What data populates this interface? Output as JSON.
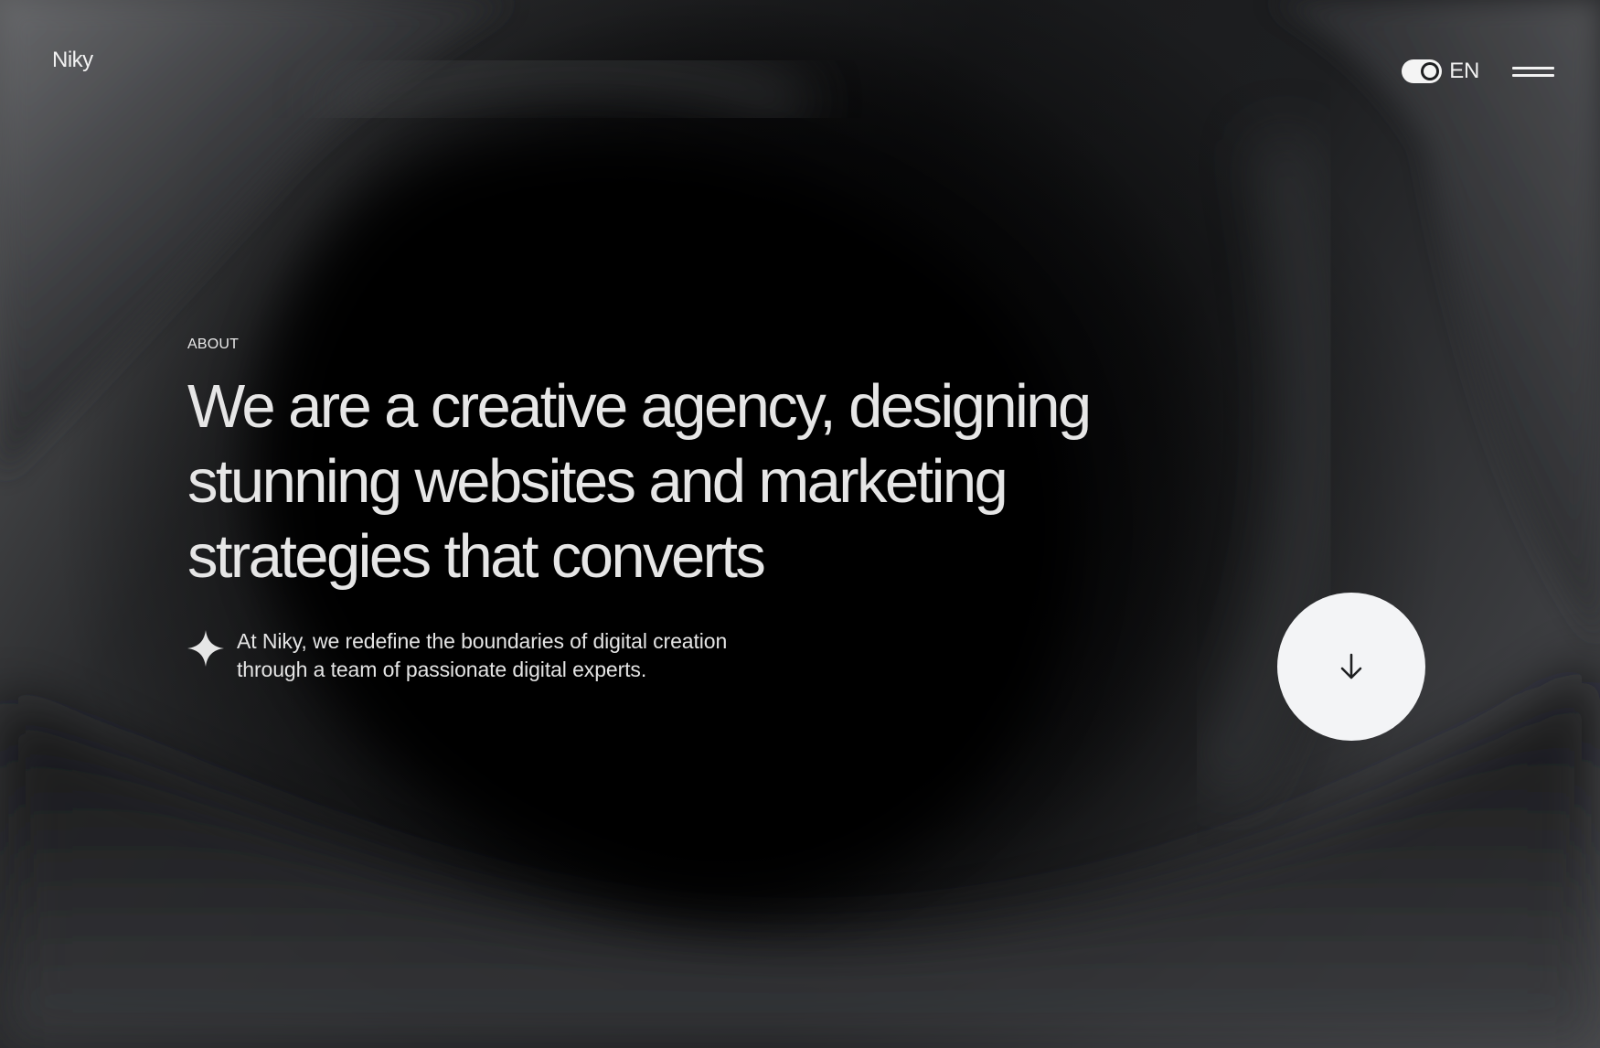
{
  "header": {
    "logo": "Niky",
    "language": "EN",
    "toggle_state": "on",
    "menu_icon": "hamburger-menu-icon"
  },
  "hero": {
    "eyebrow": "ABOUT",
    "headline_lines": [
      "We are a creative agency, designing",
      "stunning websites and marketing",
      "strategies that converts"
    ],
    "intro_icon": "sparkle-icon",
    "intro_lines": [
      "At Niky, we redefine the boundaries of digital creation",
      "through a team of passionate digital experts."
    ],
    "scroll_icon": "arrow-down-icon"
  },
  "colors": {
    "background": "#0a0a0b",
    "text": "#ececec",
    "button_bg": "#f3f4f6",
    "button_icon": "#1e1f21"
  }
}
